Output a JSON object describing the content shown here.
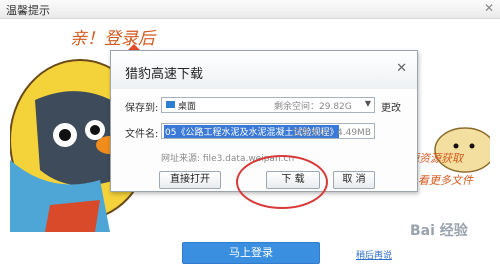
{
  "outer_window": {
    "title": "温馨提示",
    "close": "✕"
  },
  "illustration": {
    "greeting": "亲！登录后",
    "right_text_1": "源资源获取",
    "right_text_2": "看更多文件"
  },
  "dialog": {
    "title": "猎豹高速下载",
    "close": "✕",
    "save_label": "保存到:",
    "save_path": "桌面",
    "free_space": "剩余空间：29.82G",
    "change_link": "更改",
    "file_label": "文件名:",
    "file_name": "05《公路工程水泥及水泥混凝土试验规程》",
    "file_size": "文件大小：4.49MB",
    "source": "网址来源: file3.data.weipan.cn",
    "buttons": {
      "open": "直接打开",
      "download": "下 载",
      "cancel": "取 消"
    }
  },
  "footer": {
    "login": "马上登录",
    "later": "稍后再说"
  },
  "watermark": "Bai 经验"
}
